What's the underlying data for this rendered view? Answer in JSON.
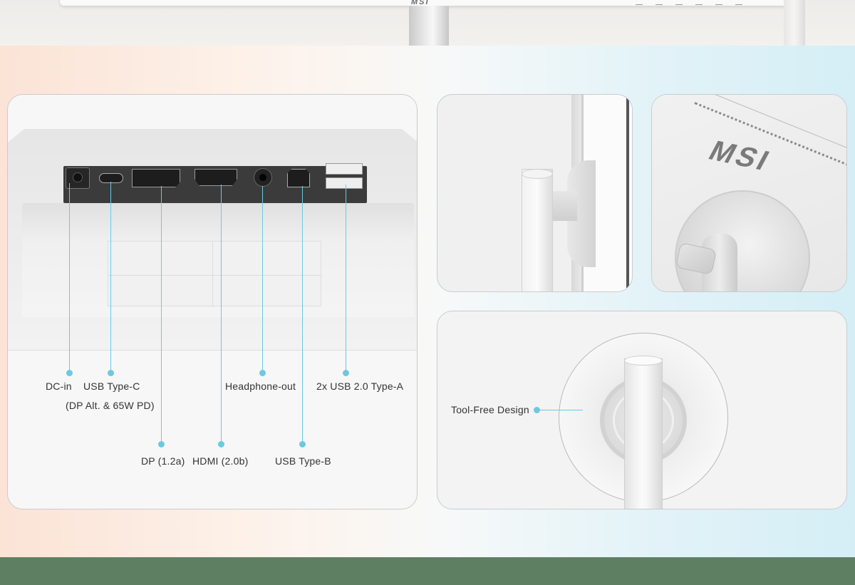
{
  "brand_logo": "MSI",
  "ports": {
    "dc_in": "DC-in",
    "usb_c": "USB Type-C",
    "usb_c_note": "(DP Alt. & 65W PD)",
    "dp": "DP (1.2a)",
    "hdmi": "HDMI (2.0b)",
    "headphone": "Headphone-out",
    "usb_b": "USB Type-B",
    "usb_a": "2x USB 2.0 Type-A"
  },
  "stand": {
    "tool_free": "Tool-Free Design"
  },
  "colors": {
    "accent": "#6cc9e0",
    "bottom_band": "#5f7f63"
  }
}
